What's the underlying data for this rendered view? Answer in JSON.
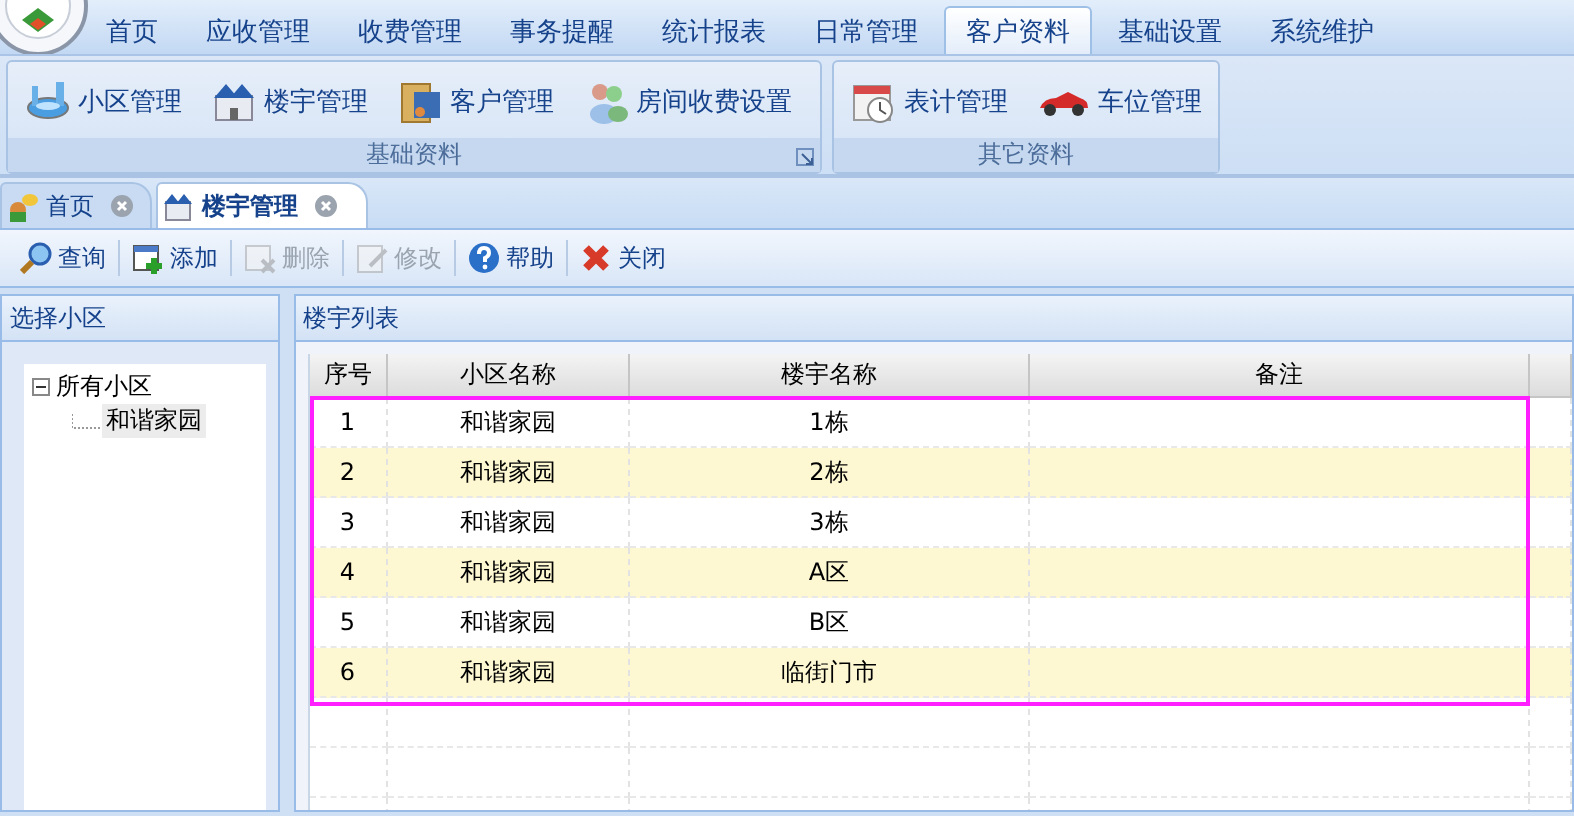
{
  "menu_tabs": [
    {
      "label": "首页",
      "selected": false
    },
    {
      "label": "应收管理",
      "selected": false
    },
    {
      "label": "收费管理",
      "selected": false
    },
    {
      "label": "事务提醒",
      "selected": false
    },
    {
      "label": "统计报表",
      "selected": false
    },
    {
      "label": "日常管理",
      "selected": false
    },
    {
      "label": "客户资料",
      "selected": true
    },
    {
      "label": "基础设置",
      "selected": false
    },
    {
      "label": "系统维护",
      "selected": false
    }
  ],
  "ribbon_groups": [
    {
      "label": "基础资料",
      "launcher": true,
      "buttons": [
        "小区管理",
        "楼宇管理",
        "客户管理",
        "房间收费设置"
      ]
    },
    {
      "label": "其它资料",
      "launcher": false,
      "buttons": [
        "表计管理",
        "车位管理"
      ]
    }
  ],
  "doc_tabs": [
    {
      "label": "首页",
      "selected": false
    },
    {
      "label": "楼宇管理",
      "selected": true
    }
  ],
  "toolbar": [
    {
      "label": "查询",
      "disabled": false
    },
    {
      "label": "添加",
      "disabled": false
    },
    {
      "label": "删除",
      "disabled": true
    },
    {
      "label": "修改",
      "disabled": true
    },
    {
      "label": "帮助",
      "disabled": false
    },
    {
      "label": "关闭",
      "disabled": false
    }
  ],
  "left_panel": {
    "title": "选择小区",
    "tree": [
      {
        "label": "所有小区",
        "expanded": true,
        "children": [
          {
            "label": "和谐家园",
            "selected": true
          }
        ]
      }
    ]
  },
  "right_panel": {
    "title": "楼宇列表",
    "columns": [
      "序号",
      "小区名称",
      "楼宇名称",
      "备注"
    ],
    "rows": [
      {
        "no": "1",
        "community": "和谐家园",
        "building": "1栋"
      },
      {
        "no": "2",
        "community": "和谐家园",
        "building": "2栋"
      },
      {
        "no": "3",
        "community": "和谐家园",
        "building": "3栋"
      },
      {
        "no": "4",
        "community": "和谐家园",
        "building": "A区"
      },
      {
        "no": "5",
        "community": "和谐家园",
        "building": "B区"
      },
      {
        "no": "6",
        "community": "和谐家园",
        "building": "临街门市"
      }
    ]
  }
}
